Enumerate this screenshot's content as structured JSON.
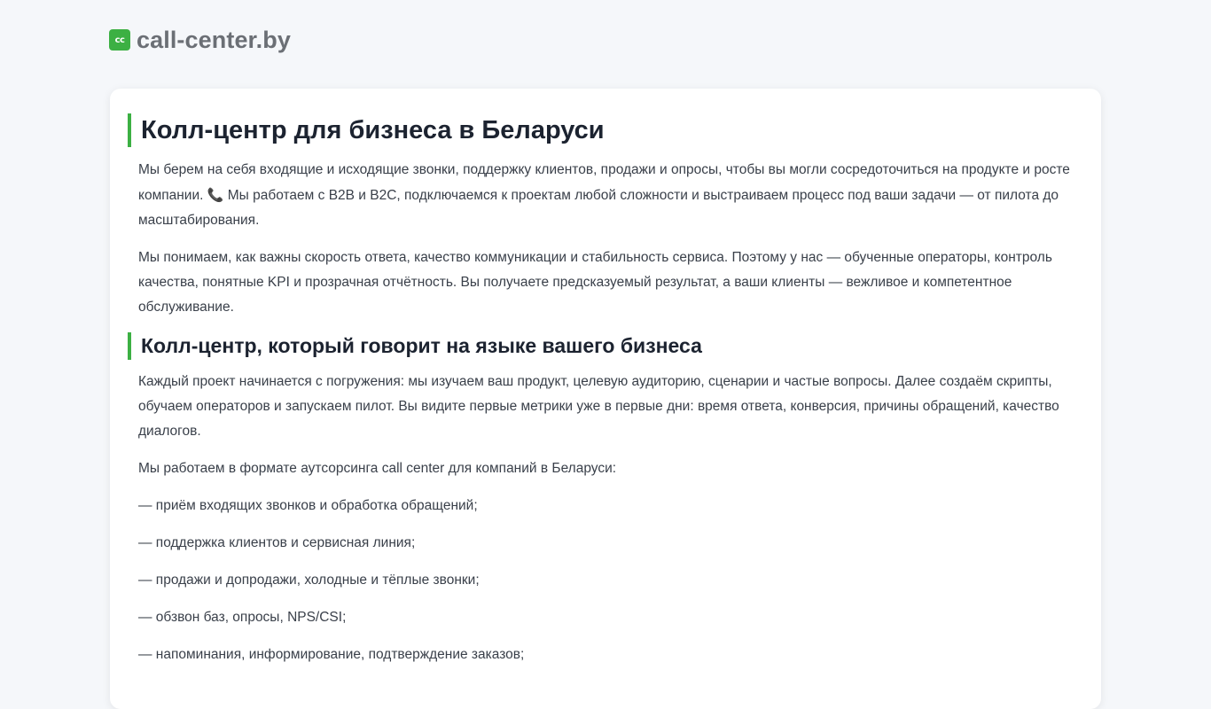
{
  "header": {
    "logo_icon": "cc-logo-icon",
    "logo_icon_text": "cc",
    "site_name": "call-center.by",
    "brand_color": "#3cb043"
  },
  "main": {
    "title": "Колл-центр для бизнеса в Беларуси",
    "intro_part1": "Мы берем на себя входящие и исходящие звонки, поддержку клиентов, продажи и опросы, чтобы вы могли сосредоточиться на продукте и росте компании.",
    "intro_icon": "phone-icon",
    "intro_part2": "Мы работаем с B2B и B2C, подключаемся к проектам любой сложности и выстраиваем процесс под ваши задачи — от пилота до масштабирования.",
    "paragraph2": "Мы понимаем, как важны скорость ответа, качество коммуникации и стабильность сервиса. Поэтому у нас — обученные операторы, контроль качества, понятные KPI и прозрачная отчётность. Вы получаете предсказуемый результат, а ваши клиенты — вежливое и компетентное обслуживание.",
    "section_title": "Колл-центр, который говорит на языке вашего бизнеса",
    "section_paragraph1": "Каждый проект начинается с погружения: мы изучаем ваш продукт, целевую аудиторию, сценарии и частые вопросы. Далее создаём скрипты, обучаем операторов и запускаем пилот. Вы видите первые метрики уже в первые дни: время ответа, конверсия, причины обращений, качество диалогов.",
    "section_paragraph2": "Мы работаем в формате аутсорсинга call center для компаний в Беларуси:",
    "services": [
      "— приём входящих звонков и обработка обращений;",
      "— поддержка клиентов и сервисная линия;",
      "— продажи и допродажи, холодные и тёплые звонки;",
      "— обзвон баз, опросы, NPS/CSI;",
      "— напоминания, информирование, подтверждение заказов;"
    ]
  }
}
